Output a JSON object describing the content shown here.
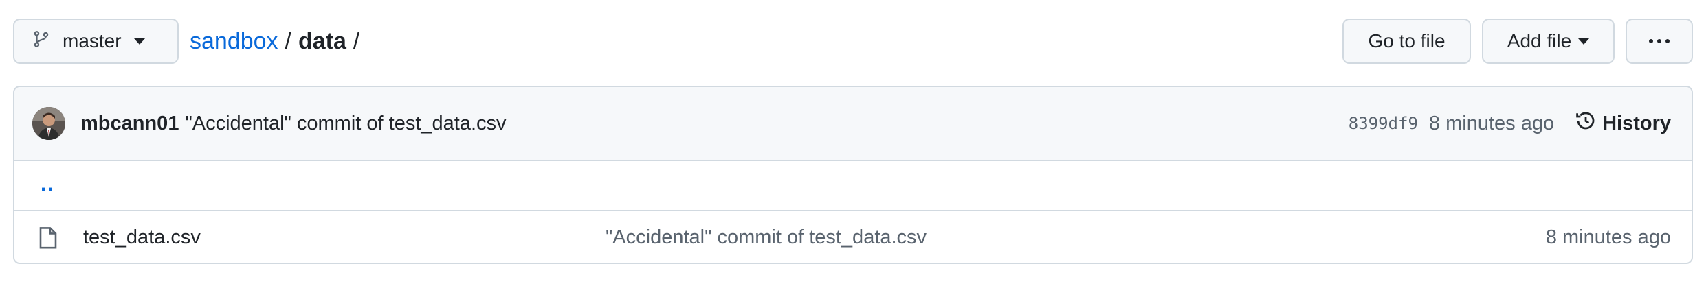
{
  "toolbar": {
    "branch": "master",
    "breadcrumb": {
      "repo": "sandbox",
      "sep1": "/",
      "folder": "data",
      "sep2": "/"
    },
    "goto_file": "Go to file",
    "add_file": "Add file",
    "more_icon": "kebab-horizontal-icon",
    "branch_icon": "git-branch-icon"
  },
  "commit": {
    "author": "mbcann01",
    "message": "\"Accidental\" commit of test_data.csv",
    "sha": "8399df9",
    "time": "8 minutes ago",
    "history_label": "History",
    "history_icon": "history-icon"
  },
  "parent_link": "..",
  "files": [
    {
      "name": "test_data.csv",
      "commit_message": "\"Accidental\" commit of test_data.csv",
      "time": "8 minutes ago",
      "icon": "file-icon"
    }
  ],
  "colors": {
    "link": "#0969da",
    "border": "#d1d9e0",
    "muted": "#59636e",
    "button_bg": "#f6f8fa"
  }
}
